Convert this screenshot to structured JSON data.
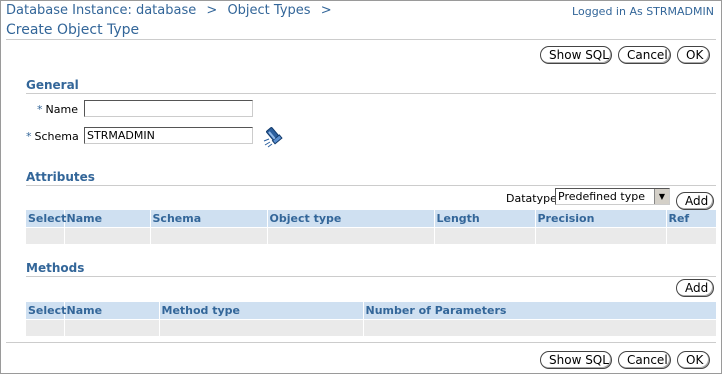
{
  "breadcrumb": {
    "items": [
      "Database Instance: database",
      "Object Types"
    ],
    "separator": ">"
  },
  "logged_in": "Logged in As STRMADMIN",
  "page_title": "Create Object Type",
  "buttons": {
    "show_sql": "Show SQL",
    "cancel": "Cancel",
    "ok": "OK",
    "add": "Add"
  },
  "general": {
    "heading": "General",
    "required_marker": "*",
    "name_label": "Name",
    "name_value": "",
    "schema_label": "Schema",
    "schema_value": "STRMADMIN"
  },
  "attributes": {
    "heading": "Attributes",
    "datatype_label": "Datatype",
    "datatype_value": "Predefined type",
    "columns": [
      "Select",
      "Name",
      "Schema",
      "Object type",
      "Length",
      "Precision",
      "Ref"
    ]
  },
  "methods": {
    "heading": "Methods",
    "columns": [
      "Select",
      "Name",
      "Method type",
      "Number of Parameters"
    ]
  },
  "icons": {
    "schema_search": "flashlight-icon",
    "dropdown": "dropdown-arrow-icon"
  },
  "colors": {
    "accent": "#336699",
    "table_header": "#cfe0f1",
    "table_row": "#eaeaea"
  }
}
